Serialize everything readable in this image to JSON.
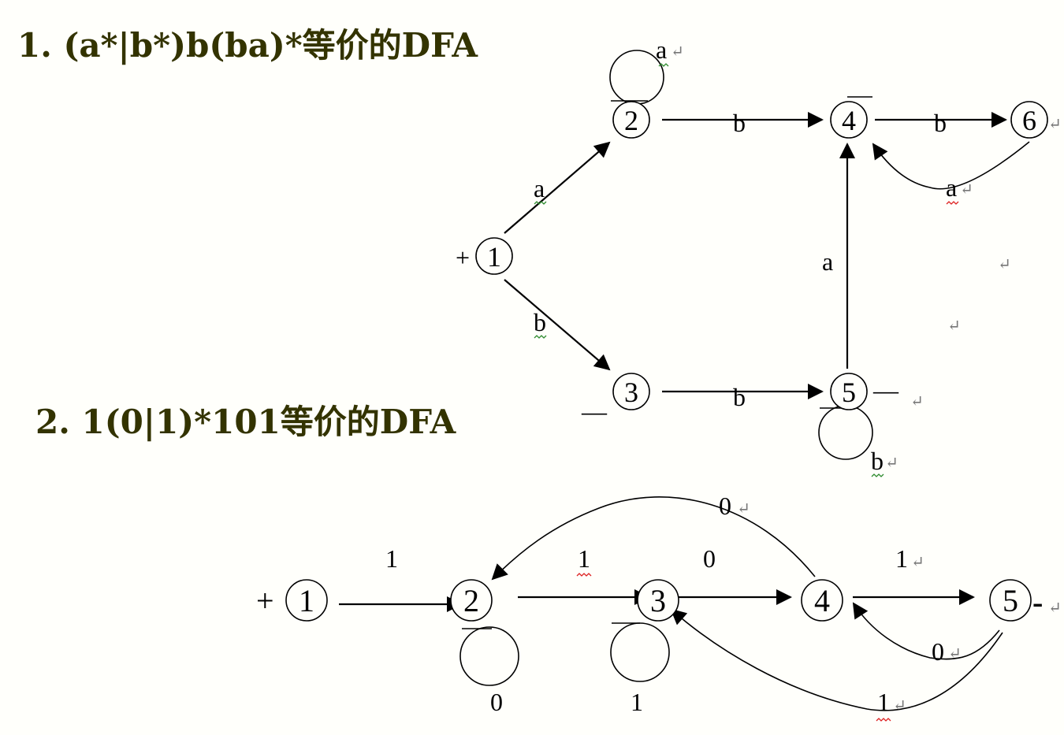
{
  "headings": {
    "dfa1": "1. (a*|b*)b(ba)*等价的DFA",
    "dfa2": "2. 1(0|1)*101等价的DFA"
  },
  "dfa1": {
    "start_marker": "+",
    "final_marker": "—",
    "nodes": [
      "1",
      "2",
      "3",
      "4",
      "5",
      "6"
    ],
    "labels": {
      "e12": "a",
      "e13": "b",
      "e24": "b",
      "e35": "b",
      "e54": "a",
      "e46": "b",
      "e64": "a",
      "loop2": "a",
      "loop5": "b"
    }
  },
  "dfa2": {
    "start_marker": "+",
    "final_marker": "-",
    "nodes": [
      "1",
      "2",
      "3",
      "4",
      "5"
    ],
    "labels": {
      "e12": "1",
      "e23": "1",
      "e34": "0",
      "e45": "1",
      "e42": "0",
      "e54": "0",
      "e53": "1",
      "loop2": "0",
      "loop3": "1"
    }
  },
  "colors": {
    "heading": "#333300",
    "background": "#fffffb",
    "edge": "#000000",
    "spellcheck_green": "#2e8b2e",
    "spellcheck_red": "#dd2222"
  },
  "return_mark": "↵"
}
